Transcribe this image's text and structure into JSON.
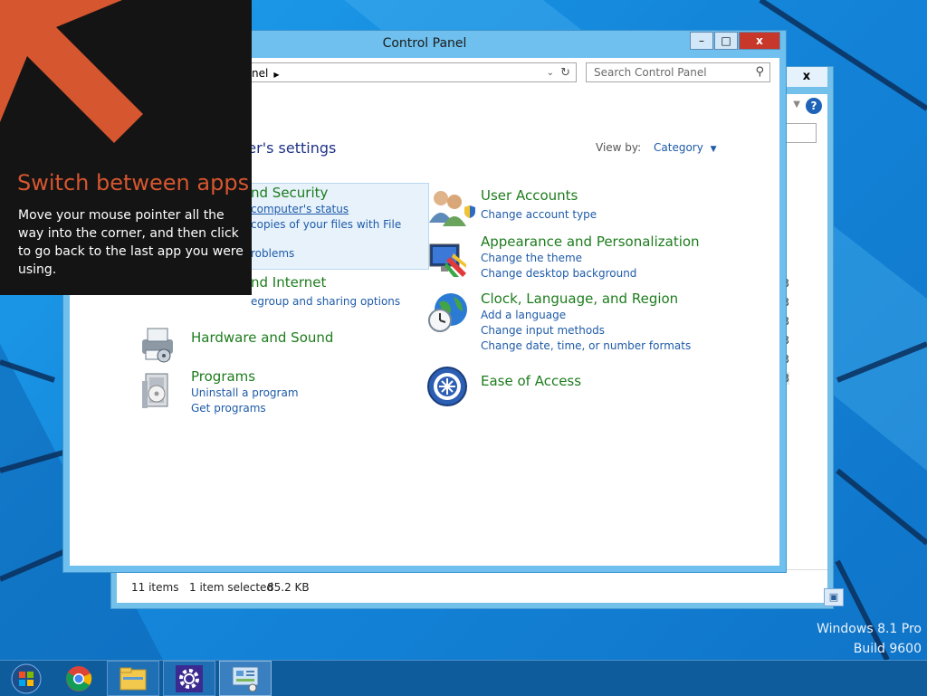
{
  "tip": {
    "title": "Switch between apps",
    "body": "Move your mouse pointer all the way into the corner, and then click to go back to the last app you were using.",
    "icon": "arrow-up-left-icon"
  },
  "control_panel": {
    "title": "Control Panel",
    "address": "nel",
    "search_placeholder": "Search Control Panel",
    "heading": "ter's settings",
    "view_by_label": "View by:",
    "view_by_value": "Category",
    "categories": [
      {
        "title": "nd Security",
        "links": [
          "computer's status",
          "copies of your files with File",
          "roblems"
        ],
        "icon": "shield-flag-icon"
      },
      {
        "title": "nd Internet",
        "links": [
          "egroup and sharing options"
        ],
        "icon": "globe-network-icon"
      },
      {
        "title": "Hardware and Sound",
        "links": [],
        "icon": "printer-icon"
      },
      {
        "title": "Programs",
        "links": [
          "Uninstall a program",
          "Get programs"
        ],
        "icon": "programs-icon"
      },
      {
        "title": "User Accounts",
        "links": [
          "Change account type"
        ],
        "icon": "users-icon"
      },
      {
        "title": "Appearance and Personalization",
        "links": [
          "Change the theme",
          "Change desktop background"
        ],
        "icon": "monitor-paint-icon"
      },
      {
        "title": "Clock, Language, and Region",
        "links": [
          "Add a language",
          "Change input methods",
          "Change date, time, or number formats"
        ],
        "icon": "globe-clock-icon"
      },
      {
        "title": "Ease of Access",
        "links": [],
        "icon": "ease-of-access-icon"
      }
    ]
  },
  "back_window": {
    "close_label": "x",
    "status_items": "11 items",
    "status_selected": "1 item selected",
    "status_size": "85.2 KB",
    "side_chars": [
      "3",
      "3",
      "3",
      "3",
      "3",
      "3"
    ]
  },
  "watermark": {
    "line1": "Windows 8.1 Pro",
    "line2": "Build 9600"
  },
  "taskbar": {
    "items": [
      "start-button",
      "chrome-icon",
      "file-explorer-icon",
      "settings-icon",
      "control-panel-icon"
    ]
  },
  "colors": {
    "desktop": "#1486da",
    "tip_accent": "#d6562f",
    "category_title": "#1d7c1d",
    "link": "#1e5ba8"
  }
}
